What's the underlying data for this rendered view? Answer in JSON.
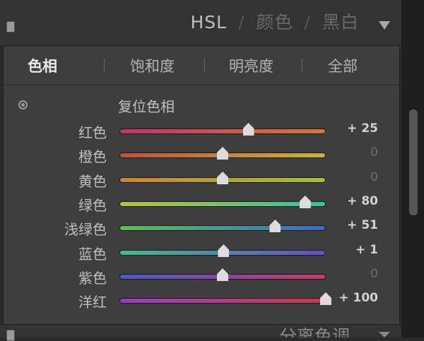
{
  "header": {
    "tabs": [
      {
        "label": "HSL"
      },
      {
        "label": "颜色"
      },
      {
        "label": "黑白"
      }
    ],
    "separator": "/",
    "collapse_icon": "panel-toggle-icon",
    "menu_icon": "triangle-down-icon"
  },
  "subtabs": [
    {
      "label": "色相",
      "active": true
    },
    {
      "label": "饱和度",
      "active": false
    },
    {
      "label": "明亮度",
      "active": false
    },
    {
      "label": "全部",
      "active": false
    }
  ],
  "reset": {
    "label": "复位色相",
    "icon": "target-reset-icon"
  },
  "sliders": [
    {
      "label": "红色",
      "value": 25,
      "display": "+ 25",
      "colors": [
        "#c0336e",
        "#d07a3a"
      ]
    },
    {
      "label": "橙色",
      "value": 0,
      "display": "0",
      "colors": [
        "#c0503a",
        "#c8b43a"
      ]
    },
    {
      "label": "黄色",
      "value": 0,
      "display": "0",
      "colors": [
        "#c8823a",
        "#a0c03a"
      ]
    },
    {
      "label": "绿色",
      "value": 80,
      "display": "+ 80",
      "colors": [
        "#b8c03a",
        "#3ac0a0"
      ]
    },
    {
      "label": "浅绿色",
      "value": 51,
      "display": "+ 51",
      "colors": [
        "#5ac050",
        "#3a6ac8"
      ]
    },
    {
      "label": "蓝色",
      "value": 1,
      "display": "+ 1",
      "colors": [
        "#3ac08a",
        "#6a4ac8"
      ]
    },
    {
      "label": "紫色",
      "value": 0,
      "display": "0",
      "colors": [
        "#4a5ac8",
        "#c83a6a"
      ]
    },
    {
      "label": "洋红",
      "value": 100,
      "display": "+ 100",
      "colors": [
        "#9a3ac8",
        "#c83a4a"
      ]
    }
  ],
  "slider_range": [
    -100,
    100
  ],
  "bottom_panel": {
    "label": "分离色调",
    "menu_icon": "triangle-down-icon"
  }
}
